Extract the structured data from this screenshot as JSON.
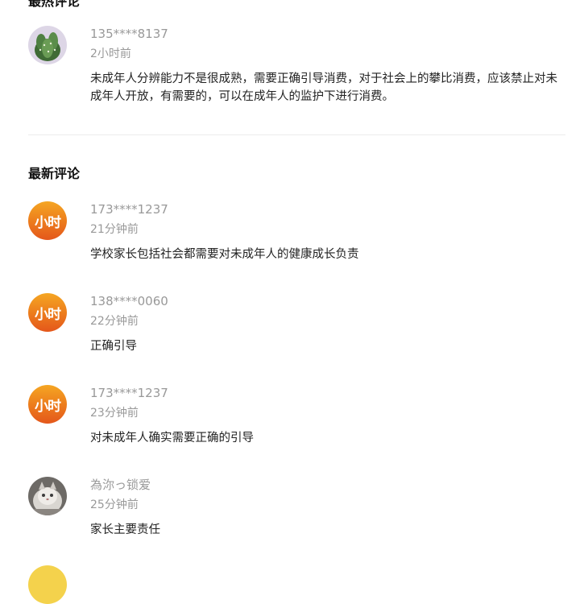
{
  "hot_section": {
    "title": "最热评论",
    "comments": [
      {
        "username": "135****8137",
        "time": "2小时前",
        "text": "未成年人分辨能力不是很成熟，需要正确引导消费，对于社会上的攀比消费，应该禁止对未成年人开放，有需要的，可以在成年人的监护下进行消费。",
        "avatar": "cactus-photo-icon"
      }
    ]
  },
  "latest_section": {
    "title": "最新评论",
    "comments": [
      {
        "username": "173****1237",
        "time": "21分钟前",
        "text": "学校家长包括社会都需要对未成年人的健康成长负责",
        "avatar": "xiaoshi-logo-icon"
      },
      {
        "username": "138****0060",
        "time": "22分钟前",
        "text": "正确引导",
        "avatar": "xiaoshi-logo-icon"
      },
      {
        "username": "173****1237",
        "time": "23分钟前",
        "text": "对未成年人确实需要正确的引导",
        "avatar": "xiaoshi-logo-icon"
      },
      {
        "username": "為沵っ锁爱",
        "time": "25分钟前",
        "text": "家长主要责任",
        "avatar": "cat-photo-icon"
      }
    ]
  },
  "brand_avatar_text": "小时",
  "colors": {
    "brand_orange": "#ec7a1c",
    "meta_gray": "#999999",
    "divider": "#ececec"
  }
}
